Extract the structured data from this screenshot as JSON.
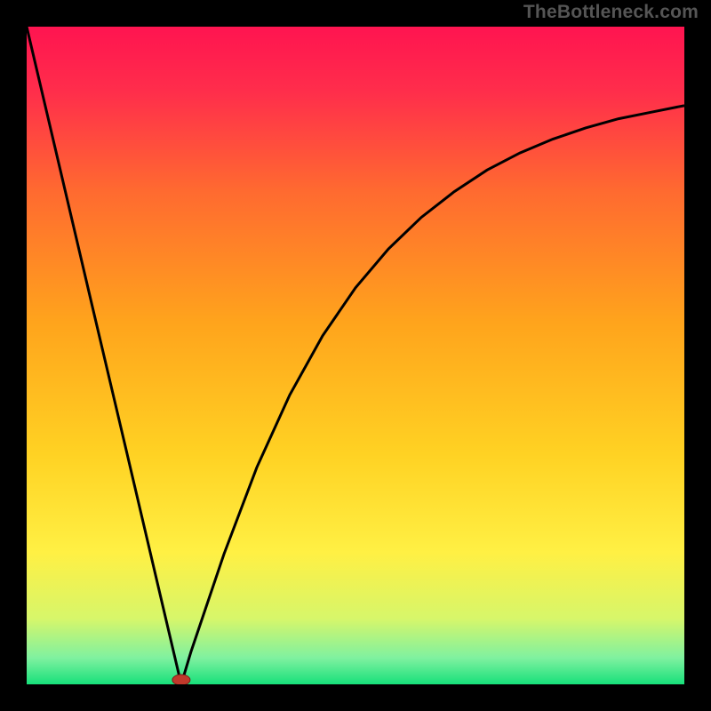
{
  "watermark": "TheBottleneck.com",
  "chart_data": {
    "type": "line",
    "title": "",
    "xlabel": "",
    "ylabel": "",
    "xlim": [
      0,
      1
    ],
    "ylim": [
      0,
      1
    ],
    "series": [
      {
        "name": "curve",
        "x": [
          0.0,
          0.05,
          0.1,
          0.15,
          0.2,
          0.235,
          0.25,
          0.3,
          0.35,
          0.4,
          0.45,
          0.5,
          0.55,
          0.6,
          0.65,
          0.7,
          0.75,
          0.8,
          0.85,
          0.9,
          0.95,
          1.0
        ],
        "y": [
          1.0,
          0.787,
          0.574,
          0.362,
          0.149,
          0.0,
          0.05,
          0.198,
          0.33,
          0.44,
          0.53,
          0.603,
          0.662,
          0.71,
          0.749,
          0.782,
          0.808,
          0.829,
          0.846,
          0.86,
          0.87,
          0.88
        ]
      }
    ],
    "marker": {
      "x": 0.235,
      "y": 0.0
    },
    "gradient_stops": [
      {
        "offset": 0.0,
        "color": "#ff1450"
      },
      {
        "offset": 0.1,
        "color": "#ff2e4b"
      },
      {
        "offset": 0.25,
        "color": "#ff6a30"
      },
      {
        "offset": 0.45,
        "color": "#ffa41c"
      },
      {
        "offset": 0.65,
        "color": "#ffd223"
      },
      {
        "offset": 0.8,
        "color": "#fff044"
      },
      {
        "offset": 0.9,
        "color": "#d7f66a"
      },
      {
        "offset": 0.96,
        "color": "#7ff1a0"
      },
      {
        "offset": 1.0,
        "color": "#17e07a"
      }
    ]
  }
}
